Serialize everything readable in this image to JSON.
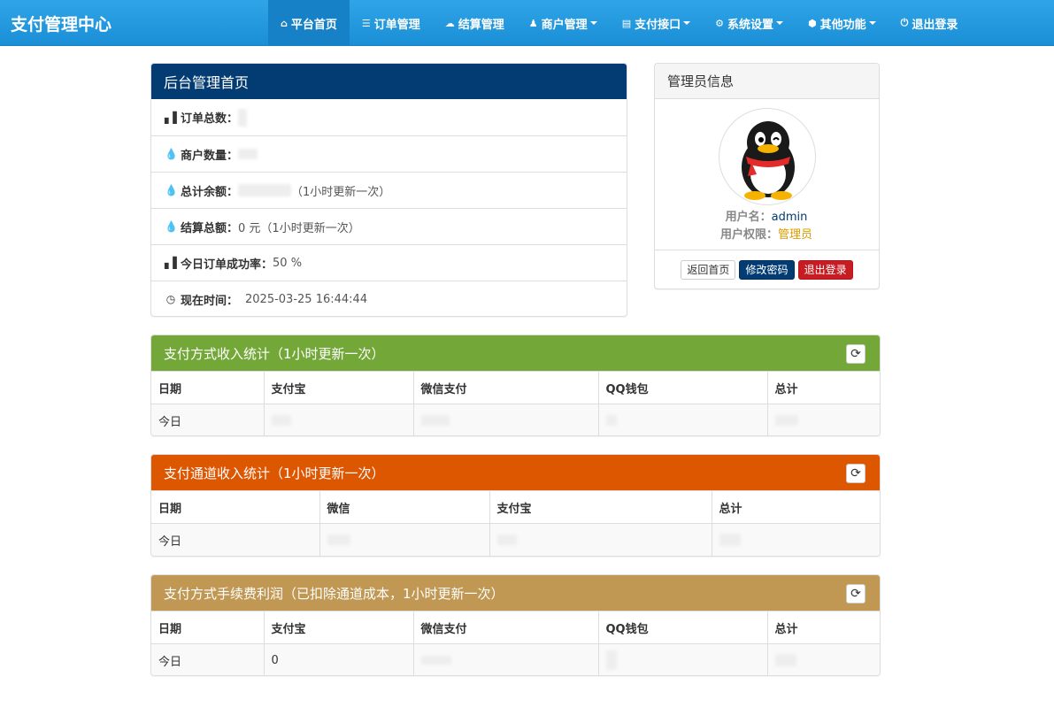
{
  "brand": "支付管理中心",
  "nav": [
    {
      "label": "平台首页",
      "icon": "home-icon",
      "dropdown": false,
      "active": true
    },
    {
      "label": "订单管理",
      "icon": "list-icon",
      "dropdown": false,
      "active": false
    },
    {
      "label": "结算管理",
      "icon": "cloud-icon",
      "dropdown": false,
      "active": false
    },
    {
      "label": "商户管理",
      "icon": "user-icon",
      "dropdown": true,
      "active": false
    },
    {
      "label": "支付接口",
      "icon": "credit-card-icon",
      "dropdown": true,
      "active": false
    },
    {
      "label": "系统设置",
      "icon": "cog-icon",
      "dropdown": true,
      "active": false
    },
    {
      "label": "其他功能",
      "icon": "cube-icon",
      "dropdown": true,
      "active": false
    },
    {
      "label": "退出登录",
      "icon": "power-icon",
      "dropdown": false,
      "active": false
    }
  ],
  "home_panel": {
    "title": "后台管理首页",
    "rows": [
      {
        "label": "订单总数：",
        "value": "",
        "note": "",
        "icon": "bar-chart-icon"
      },
      {
        "label": "商户数量：",
        "value": "",
        "note": "",
        "icon": "tint-icon"
      },
      {
        "label": "总计余额：",
        "value": "",
        "note": "（1小时更新一次）",
        "icon": "tint-icon"
      },
      {
        "label": "结算总额：",
        "value": "0 元",
        "note": "（1小时更新一次）",
        "icon": "tint-icon"
      },
      {
        "label": "今日订单成功率：",
        "value": "50 %",
        "note": "",
        "icon": "bar-chart-icon"
      },
      {
        "label": "现在时间：",
        "value": "2025-03-25 16:44:44",
        "note": "",
        "icon": "clock-icon"
      }
    ]
  },
  "admin_panel": {
    "title": "管理员信息",
    "username_label": "用户名：",
    "username": "admin",
    "role_label": "用户权限：",
    "role": "管理员",
    "buttons": {
      "home": "返回首页",
      "change_pwd": "修改密码",
      "logout": "退出登录"
    }
  },
  "stats": [
    {
      "title": "支付方式收入统计（1小时更新一次）",
      "color": "#73a839",
      "columns": [
        "日期",
        "支付宝",
        "微信支付",
        "QQ钱包",
        "总计"
      ],
      "row": [
        "今日",
        "",
        "",
        "",
        ""
      ]
    },
    {
      "title": "支付通道收入统计（1小时更新一次）",
      "color": "#dd5600",
      "columns": [
        "日期",
        "微信",
        "支付宝",
        "总计"
      ],
      "row": [
        "今日",
        "",
        "",
        ""
      ]
    },
    {
      "title": "支付方式手续费利润（已扣除通道成本，1小时更新一次）",
      "color": "#c09853",
      "columns": [
        "日期",
        "支付宝",
        "微信支付",
        "QQ钱包",
        "总计"
      ],
      "row": [
        "今日",
        "0",
        "",
        "",
        ""
      ]
    }
  ],
  "colors": {
    "navbar": "#2fa4e7",
    "home_heading": "#033c73",
    "link": "#2a6496",
    "role": "#dd9b00"
  }
}
